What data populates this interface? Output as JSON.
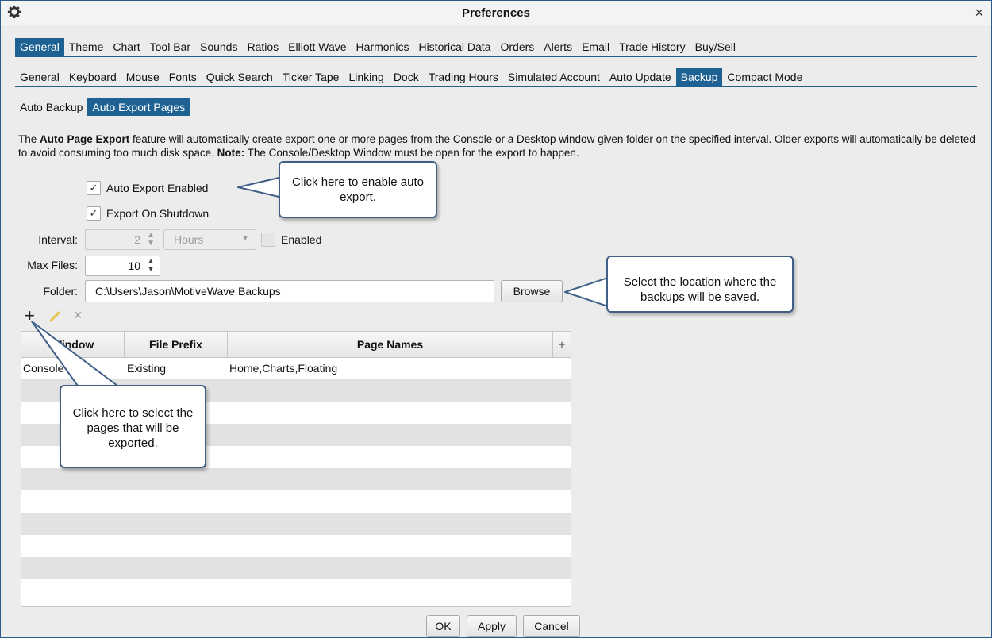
{
  "window": {
    "title": "Preferences",
    "gear_icon": "gear-icon",
    "close_label": "×"
  },
  "tabs_main": [
    "General",
    "Theme",
    "Chart",
    "Tool Bar",
    "Sounds",
    "Ratios",
    "Elliott Wave",
    "Harmonics",
    "Historical Data",
    "Orders",
    "Alerts",
    "Email",
    "Trade History",
    "Buy/Sell"
  ],
  "tabs_sub": [
    "General",
    "Keyboard",
    "Mouse",
    "Fonts",
    "Quick Search",
    "Ticker Tape",
    "Linking",
    "Dock",
    "Trading Hours",
    "Simulated Account",
    "Auto Update",
    "Backup",
    "Compact Mode"
  ],
  "tabs_backup": [
    "Auto Backup",
    "Auto Export Pages"
  ],
  "description": {
    "part1": "The ",
    "bold1": "Auto Page Export",
    "part2": " feature will automatically create export one or more pages from the Console or a Desktop window given folder on the specified interval. Older exports will automatically be deleted to avoid consuming too much disk space.  ",
    "bold2": "Note:",
    "part3": " The Console/Desktop Window must be open for the export to happen."
  },
  "form": {
    "auto_export_label": "Auto Export Enabled",
    "auto_export_checked": true,
    "export_shutdown_label": "Export On Shutdown",
    "export_shutdown_checked": true,
    "interval_label": "Interval:",
    "interval_value": "2",
    "interval_unit": "Hours",
    "interval_enabled_label": "Enabled",
    "max_files_label": "Max Files:",
    "max_files_value": "10",
    "folder_label": "Folder:",
    "folder_value": "C:\\Users\\Jason\\MotiveWave Backups",
    "browse_label": "Browse"
  },
  "table": {
    "columns": [
      "Window",
      "File Prefix",
      "Page Names"
    ],
    "rows": [
      {
        "window": "Console",
        "prefix": "Existing",
        "pages": "Home,Charts,Floating"
      }
    ]
  },
  "toolbar": {
    "add": "+",
    "edit_icon": "pencil-icon",
    "remove": "×"
  },
  "footer": {
    "ok": "OK",
    "apply": "Apply",
    "cancel": "Cancel"
  },
  "callouts": {
    "auto_export": "Click here to enable auto export.",
    "browse": "Select the location where the backups will be saved.",
    "add": "Click here to select the pages that will be exported."
  },
  "colors": {
    "selected_tab": "#1e6294",
    "callout_border": "#3f5f86"
  }
}
